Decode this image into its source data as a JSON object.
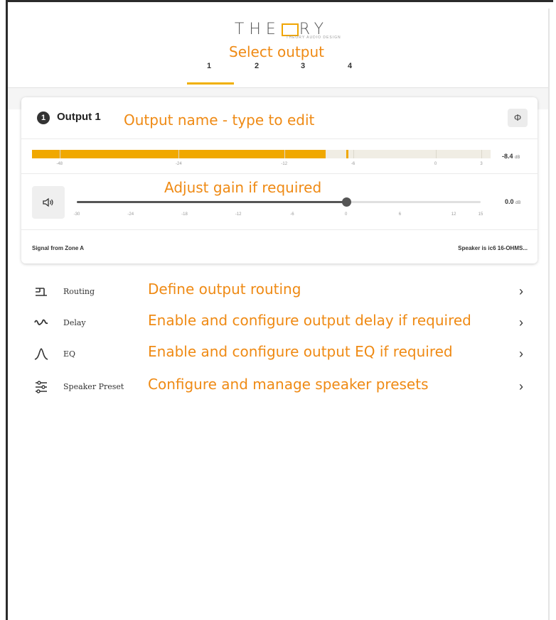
{
  "brand": {
    "logo_prefix": "THE",
    "logo_suffix": "RY",
    "logo_tagline": "THEORY AUDIO DESIGN"
  },
  "annotations": {
    "select_output": "Select output",
    "output_name": "Output name - type to edit",
    "adjust_gain": "Adjust gain if required"
  },
  "tabs": [
    {
      "label": "1",
      "selected": true
    },
    {
      "label": "2",
      "selected": false
    },
    {
      "label": "3",
      "selected": false
    },
    {
      "label": "4",
      "selected": false
    }
  ],
  "output": {
    "number": "1",
    "name": "Output 1",
    "phase_icon": "phase-invert-icon",
    "meter": {
      "value": "-8.4",
      "unit": "dB",
      "level_db": -8.4,
      "peak_db": -7.2,
      "scale_labels": [
        "-48",
        "-24",
        "-12",
        "-6",
        "0",
        "3"
      ]
    },
    "gain": {
      "value": "0.0",
      "unit": "dB",
      "level_db": 0,
      "scale_labels": [
        "-30",
        "-24",
        "-18",
        "-12",
        "-6",
        "0",
        "6",
        "12",
        "15"
      ]
    },
    "signal_source": "Signal from Zone A",
    "speaker_info": "Speaker is ic6 16-OHMS..."
  },
  "menu": [
    {
      "label": "Routing",
      "icon": "routing-icon",
      "note": "Define output routing"
    },
    {
      "label": "Delay",
      "icon": "delay-waveform-icon",
      "note": "Enable and configure output delay if required"
    },
    {
      "label": "EQ",
      "icon": "eq-curve-icon",
      "note": "Enable and configure output EQ if required"
    },
    {
      "label": "Speaker Preset",
      "icon": "sliders-icon",
      "note": "Configure and manage speaker presets"
    }
  ],
  "colors": {
    "accent": "#f0a800",
    "annotation": "#ef8a14"
  }
}
